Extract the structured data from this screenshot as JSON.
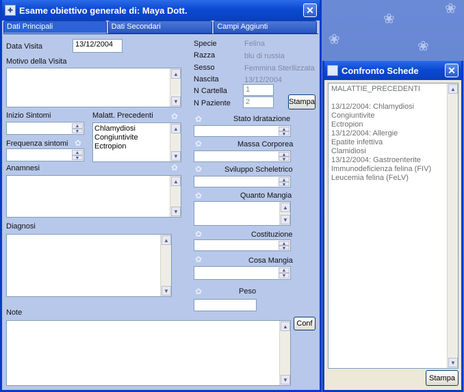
{
  "main": {
    "title": "Esame obiettivo generale di: Maya  Dott.",
    "tabs": [
      "Dati Principali",
      "Dati Secondari",
      "Campi Aggiunti"
    ],
    "labels": {
      "data_visita": "Data Visita",
      "motivo": "Motivo della Visita",
      "inizio": "Inizio Sintomi",
      "malatt": "Malatt. Precedenti",
      "frequenza": "Frequenza sintomi",
      "anamnesi": "Anamnesi",
      "diagnosi": "Diagnosi",
      "note": "Note",
      "specie": "Specie",
      "razza": "Razza",
      "sesso": "Sesso",
      "nascita": "Nascita",
      "ncartella": "N Cartella",
      "npaziente": "N Paziente",
      "stato": "Stato Idratazione",
      "massa": "Massa Corporea",
      "sviluppo": "Sviluppo Scheletrico",
      "quanto": "Quanto Mangia",
      "costituzione": "Costituzione",
      "cosa": "Cosa Mangia",
      "peso": "Peso"
    },
    "values": {
      "data_visita": "13/12/2004",
      "specie": "Felina",
      "razza": "blu di russia",
      "sesso": "Femmina Sterilizzata",
      "nascita": "13/12/2004",
      "ncartella": "1",
      "npaziente": "2"
    },
    "malatt_list": [
      "Chlamydiosi",
      "Congiuntivite",
      "Ectropion"
    ],
    "buttons": {
      "stampa": "Stampa",
      "conf": "Conf"
    }
  },
  "side": {
    "title": "Confronto Schede",
    "lines": [
      "MALATTIE_PRECEDENTI",
      "",
      "13/12/2004: Chlamydiosi",
      "Congiuntivite",
      "Ectropion",
      "13/12/2004: Allergie",
      "Epatite infettiva",
      "Clamidiosi",
      "13/12/2004: Gastroenterite",
      "Immunodeficienza felina (FIV)",
      "Leucemia felina (FeLV)"
    ],
    "stampa": "Stampa"
  }
}
